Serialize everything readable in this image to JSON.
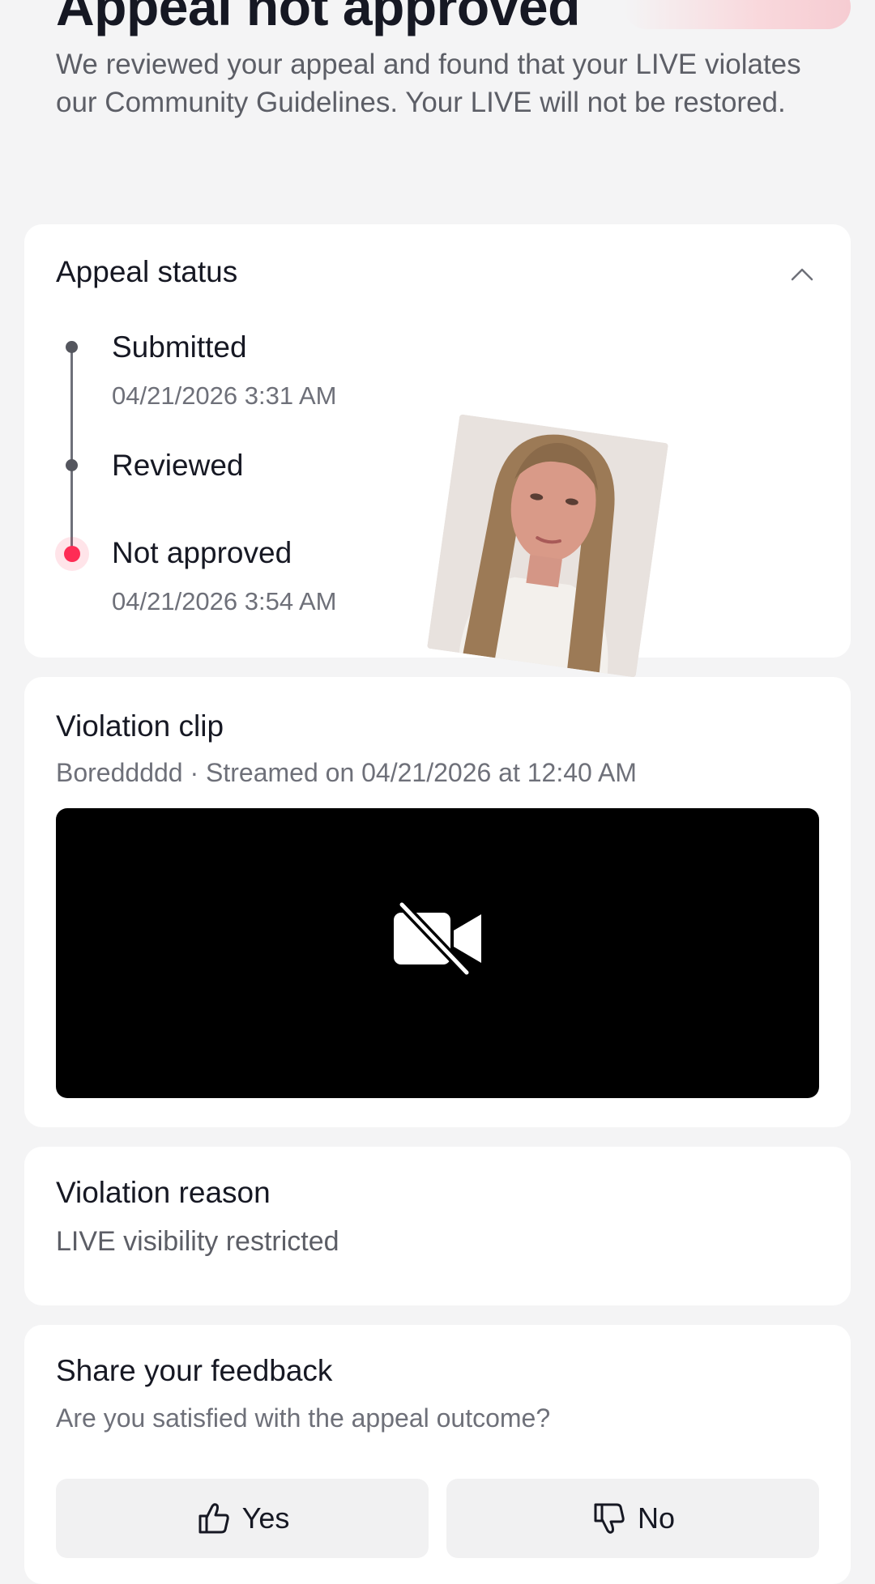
{
  "header": {
    "title": "Appeal not approved",
    "description": "We reviewed your appeal and found that your LIVE violates our Community Guidelines. Your LIVE will not be restored."
  },
  "appeal_status": {
    "title": "Appeal status",
    "steps": [
      {
        "label": "Submitted",
        "time": "04/21/2026 3:31 AM"
      },
      {
        "label": "Reviewed",
        "time": ""
      },
      {
        "label": "Not approved",
        "time": "04/21/2026 3:54 AM"
      }
    ]
  },
  "violation_clip": {
    "title": "Violation clip",
    "subtitle": "Boreddddd · Streamed on 04/21/2026 at 12:40 AM",
    "icon": "video-off-icon"
  },
  "violation_reason": {
    "title": "Violation reason",
    "value": "LIVE visibility restricted"
  },
  "feedback": {
    "title": "Share your feedback",
    "question": "Are you satisfied with the appeal outcome?",
    "yes_label": "Yes",
    "no_label": "No"
  },
  "colors": {
    "accent": "#fe2c55",
    "background": "#f4f4f5",
    "card": "#ffffff"
  }
}
